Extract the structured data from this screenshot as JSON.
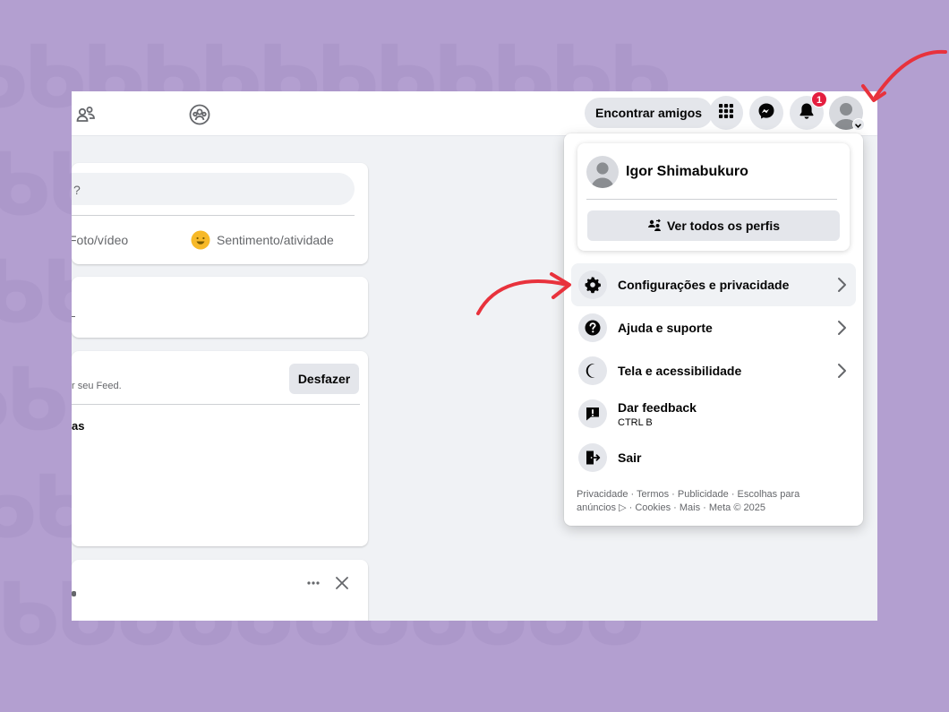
{
  "header": {
    "find_friends": "Encontrar amigos",
    "notification_count": "1",
    "icons": [
      "friends-icon",
      "groups-icon",
      "apps-grid-icon",
      "messenger-icon",
      "bell-icon",
      "avatar-icon"
    ]
  },
  "feed": {
    "composer_placeholder": "?",
    "photo_video": "Foto/vídeo",
    "feeling_activity": "Sentimento/atividade",
    "feed_notice": "r seu Feed.",
    "undo_button": "Desfazer",
    "partial_text": "as"
  },
  "account_menu": {
    "profile_name": "Igor Shimabukuro",
    "see_all_profiles": "Ver todos os perfis",
    "items": [
      {
        "label": "Configurações e privacidade",
        "icon": "gear-icon"
      },
      {
        "label": "Ajuda e suporte",
        "icon": "help-icon"
      },
      {
        "label": "Tela e acessibilidade",
        "icon": "moon-icon"
      },
      {
        "label": "Dar feedback",
        "sub": "CTRL B",
        "icon": "feedback-icon"
      },
      {
        "label": "Sair",
        "icon": "logout-icon"
      }
    ],
    "footer_line1": "Privacidade · Termos · Publicidade · Escolhas para",
    "footer_line2": "anúncios ▷ · Cookies · Mais · Meta © 2025"
  },
  "colors": {
    "background": "#b39fd0",
    "annotation_arrow": "#e8323c",
    "notification_badge": "#e41e3f"
  }
}
